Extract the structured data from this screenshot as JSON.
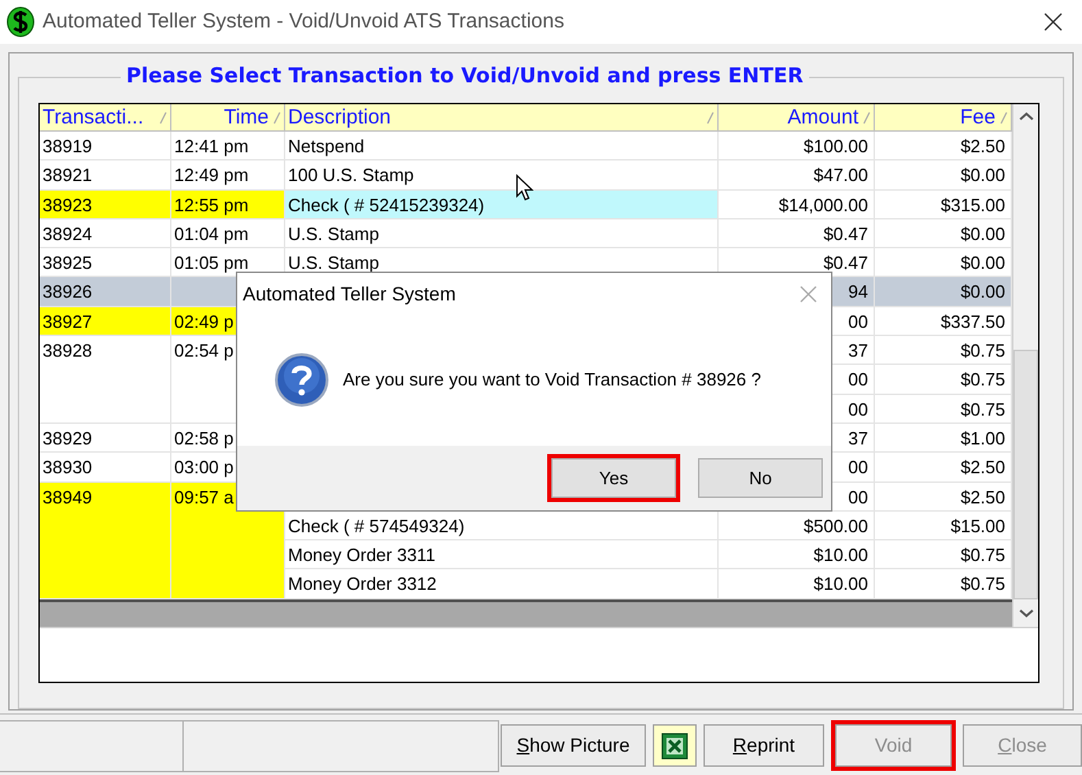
{
  "window": {
    "title": "Automated Teller System - Void/Unvoid ATS Transactions"
  },
  "group": {
    "label": "Please Select Transaction to Void/Unvoid and press ENTER"
  },
  "table": {
    "columns": [
      {
        "label": "Transacti..."
      },
      {
        "label": "Time"
      },
      {
        "label": "Description"
      },
      {
        "label": "Amount"
      },
      {
        "label": "Fee"
      }
    ],
    "rows": [
      {
        "id": "38919",
        "time": "12:41 pm",
        "flagged": false,
        "selected": false,
        "lines": [
          {
            "description": "Netspend",
            "amount": "$100.00",
            "fee": "$2.50",
            "highlighted": false
          }
        ]
      },
      {
        "id": "38921",
        "time": "12:49 pm",
        "flagged": false,
        "selected": false,
        "lines": [
          {
            "description": "100 U.S. Stamp",
            "amount": "$47.00",
            "fee": "$0.00",
            "highlighted": false
          }
        ]
      },
      {
        "id": "38923",
        "time": "12:55 pm",
        "flagged": true,
        "selected": false,
        "lines": [
          {
            "description": "Check ( # 52415239324)",
            "amount": "$14,000.00",
            "fee": "$315.00",
            "highlighted": true
          }
        ]
      },
      {
        "id": "38924",
        "time": "01:04 pm",
        "flagged": false,
        "selected": false,
        "lines": [
          {
            "description": "U.S. Stamp",
            "amount": "$0.47",
            "fee": "$0.00",
            "highlighted": false
          }
        ]
      },
      {
        "id": "38925",
        "time": "01:05 pm",
        "flagged": false,
        "selected": false,
        "lines": [
          {
            "description": "U.S. Stamp",
            "amount": "$0.47",
            "fee": "$0.00",
            "highlighted": false
          }
        ]
      },
      {
        "id": "38926",
        "flagged": false,
        "selected": true,
        "lines": [
          {
            "amount": "94",
            "fee": "$0.00"
          }
        ]
      },
      {
        "id": "38927",
        "time": "02:49 p",
        "flagged": true,
        "selected": false,
        "lines": [
          {
            "amount": "00",
            "fee": "$337.50"
          }
        ]
      },
      {
        "id": "38928",
        "time": "02:54 p",
        "flagged": false,
        "selected": false,
        "lines": [
          {
            "amount": "37",
            "fee": "$0.75"
          },
          {
            "amount": "00",
            "fee": "$0.75"
          },
          {
            "amount": "00",
            "fee": "$0.75"
          }
        ]
      },
      {
        "id": "38929",
        "time": "02:58 p",
        "flagged": false,
        "selected": false,
        "lines": [
          {
            "amount": "37",
            "fee": "$1.00"
          }
        ]
      },
      {
        "id": "38930",
        "time": "03:00 p",
        "flagged": false,
        "selected": false,
        "lines": [
          {
            "amount": "00",
            "fee": "$2.50"
          }
        ]
      },
      {
        "id": "38949",
        "time": "09:57 a",
        "flagged": true,
        "selected": false,
        "lines": [
          {
            "amount": "00",
            "fee": "$2.50"
          },
          {
            "description": "Check ( # 574549324)",
            "amount": "$500.00",
            "fee": "$15.00",
            "highlighted": false
          },
          {
            "description": "Money Order 3311",
            "amount": "$10.00",
            "fee": "$0.75",
            "highlighted": false
          },
          {
            "description": "Money Order 3312",
            "amount": "$10.00",
            "fee": "$0.75",
            "highlighted": false
          }
        ]
      }
    ]
  },
  "dialog": {
    "title": "Automated Teller System",
    "message": "Are you sure you want to Void Transaction # 38926 ?",
    "buttons": [
      {
        "label": "Yes",
        "outlined": true
      },
      {
        "label": "No",
        "outlined": false
      }
    ]
  },
  "toolbar": {
    "buttons": [
      {
        "kind": "text",
        "label": "Show Picture",
        "underline_first": true,
        "disabled": false,
        "outlined": false
      },
      {
        "kind": "excel"
      },
      {
        "kind": "text",
        "label": "Reprint",
        "underline_first": true,
        "disabled": false,
        "outlined": false
      },
      {
        "kind": "text",
        "label": "Void",
        "underline_first": false,
        "disabled": true,
        "outlined": true
      },
      {
        "kind": "text",
        "label": "Close",
        "underline_first": true,
        "disabled": true,
        "outlined": false
      }
    ]
  }
}
